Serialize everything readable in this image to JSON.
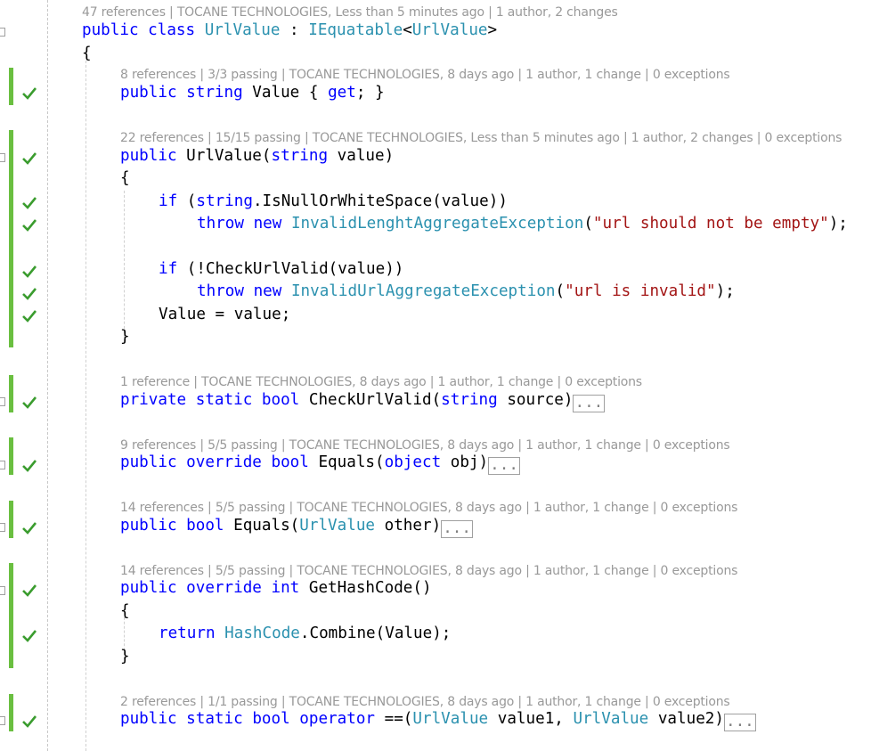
{
  "codelens": {
    "class": "47 references | TOCANE TECHNOLOGIES, Less than 5 minutes ago | 1 author, 2 changes",
    "value_prop": "8 references | 3/3 passing | TOCANE TECHNOLOGIES, 8 days ago | 1 author, 1 change | 0 exceptions",
    "ctor": "22 references | 15/15 passing | TOCANE TECHNOLOGIES, Less than 5 minutes ago | 1 author, 2 changes | 0 exceptions",
    "check_url": "1 reference | TOCANE TECHNOLOGIES, 8 days ago | 1 author, 1 change | 0 exceptions",
    "equals_obj": "9 references | 5/5 passing | TOCANE TECHNOLOGIES, 8 days ago | 1 author, 1 change | 0 exceptions",
    "equals_other": "14 references | 5/5 passing | TOCANE TECHNOLOGIES, 8 days ago | 1 author, 1 change | 0 exceptions",
    "hashcode": "14 references | 5/5 passing | TOCANE TECHNOLOGIES, 8 days ago | 1 author, 1 change | 0 exceptions",
    "operator": "2 references | 1/1 passing | TOCANE TECHNOLOGIES, 8 days ago | 1 author, 1 change | 0 exceptions"
  },
  "code": {
    "kw_public": "public",
    "kw_class": "class",
    "class_name": "UrlValue",
    "colon": " : ",
    "iequatable": "IEquatable",
    "lt": "<",
    "gt": ">",
    "open_brace": "{",
    "close_brace": "}",
    "kw_string": "string",
    "value_prop_name": " Value { ",
    "kw_get": "get",
    "value_prop_end": "; }",
    "ctor_name": " UrlValue(",
    "ctor_param": " value)",
    "kw_if": "if",
    "if1_a": " (",
    "if1_b": ".IsNullOrWhiteSpace(value))",
    "kw_throw": "throw",
    "kw_new": "new",
    "exc1_type": "InvalidLenghtAggregateException",
    "exc1_open": "(",
    "exc1_msg": "\"url should not be empty\"",
    "exc_close": ");",
    "if2_body": " (!CheckUrlValid(value))",
    "exc2_type": "InvalidUrlAggregateException",
    "exc2_msg": "\"url is invalid\"",
    "assign": "Value = value;",
    "kw_private": "private",
    "kw_static": "static",
    "kw_bool": "bool",
    "check_sig": " CheckUrlValid(",
    "check_param": " source)",
    "ellipsis": "...",
    "kw_override": "override",
    "equals_name": " Equals(",
    "kw_object": "object",
    "obj_param": " obj)",
    "other_param": " other)",
    "kw_int": "int",
    "hash_sig": " GetHashCode()",
    "kw_return": "return",
    "hashcode_type": "HashCode",
    "combine": ".Combine(Value);",
    "kw_operator": "operator",
    "op_sig": " ==(",
    "p1": " value1, ",
    "p2": " value2)"
  },
  "colors": {
    "keyword": "#0000ff",
    "type": "#2b91af",
    "string": "#a31515",
    "codelens": "#999999",
    "coverage": "#6abf40",
    "check": "#3a9c2e"
  },
  "icons": {
    "check": "check-icon",
    "fold": "fold-toggle-icon"
  }
}
